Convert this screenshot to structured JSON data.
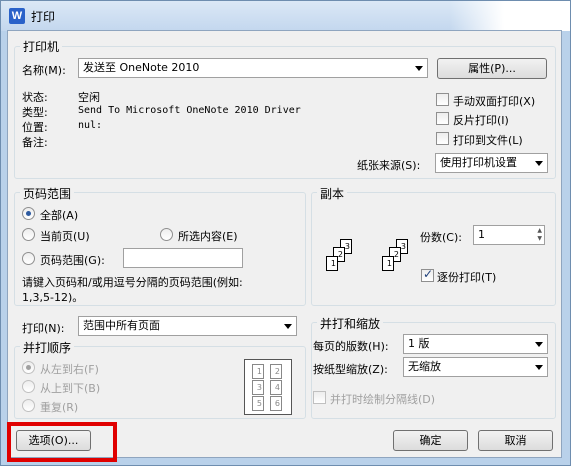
{
  "window": {
    "title": "打印",
    "app_icon_letter": "W"
  },
  "printer": {
    "group_label": "打印机",
    "name_label": "名称(M):",
    "name_value": "发送至 OneNote 2010",
    "properties_button": "属性(P)...",
    "status_label": "状态:",
    "status_value": "空闲",
    "type_label": "类型:",
    "type_value": "Send To Microsoft OneNote 2010 Driver",
    "location_label": "位置:",
    "location_value": "nul:",
    "comment_label": "备注:",
    "manual_duplex": "手动双面打印(X)",
    "reverse_print": "反片打印(I)",
    "print_to_file": "打印到文件(L)",
    "paper_source_label": "纸张来源(S):",
    "paper_source_value": "使用打印机设置"
  },
  "page_range": {
    "group_label": "页码范围",
    "all": "全部(A)",
    "current_page": "当前页(U)",
    "selection": "所选内容(E)",
    "pages": "页码范围(G):",
    "pages_value": "",
    "hint_line1": "请键入页码和/或用逗号分隔的页码范围(例如:",
    "hint_line2": "1,3,5-12)。"
  },
  "copies": {
    "group_label": "副本",
    "count_label": "份数(C):",
    "count_value": "1",
    "collate": "逐份打印(T)"
  },
  "print_what": {
    "label": "打印(N):",
    "value": "范围中所有页面"
  },
  "collate_order": {
    "group_label": "并打顺序",
    "left_to_right": "从左到右(F)",
    "top_to_bottom": "从上到下(B)",
    "repeat": "重复(R)"
  },
  "zoom": {
    "group_label": "并打和缩放",
    "pages_per_sheet_label": "每页的版数(H):",
    "pages_per_sheet_value": "1 版",
    "scale_label": "按纸型缩放(Z):",
    "scale_value": "无缩放",
    "draw_borders": "并打时绘制分隔线(D)"
  },
  "buttons": {
    "options": "选项(O)...",
    "ok": "确定",
    "cancel": "取消"
  },
  "colors": {
    "highlight": "#e00000",
    "title_bar": "#c3d7ee"
  }
}
